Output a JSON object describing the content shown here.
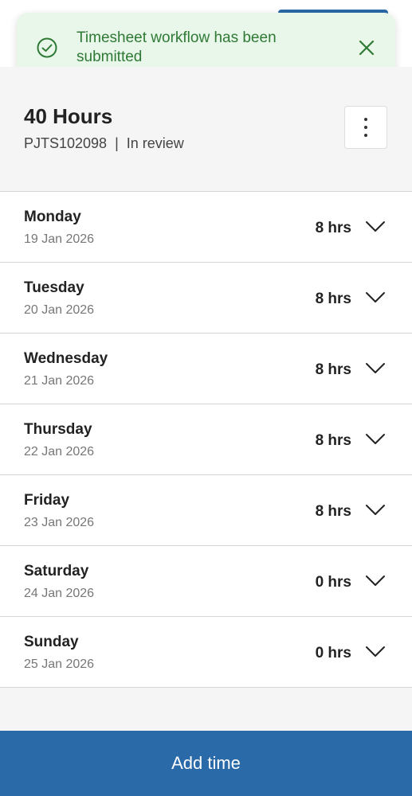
{
  "toast": {
    "message_line1": "Timesheet workflow has been",
    "message_line2": "submitted",
    "status_icon": "check-circle-icon",
    "close_icon": "close-icon",
    "color": "#2e7a35",
    "background": "#e9f6ea"
  },
  "summary": {
    "title": "40 Hours",
    "meta": "PJTS102098  |  In review",
    "more_icon": "more-vertical-icon"
  },
  "days": [
    {
      "name": "Monday",
      "date": "19 Jan 2026",
      "hours": "8 hrs"
    },
    {
      "name": "Tuesday",
      "date": "20 Jan 2026",
      "hours": "8 hrs"
    },
    {
      "name": "Wednesday",
      "date": "21 Jan 2026",
      "hours": "8 hrs"
    },
    {
      "name": "Thursday",
      "date": "22 Jan 2026",
      "hours": "8 hrs"
    },
    {
      "name": "Friday",
      "date": "23 Jan 2026",
      "hours": "8 hrs"
    },
    {
      "name": "Saturday",
      "date": "24 Jan 2026",
      "hours": "0 hrs"
    },
    {
      "name": "Sunday",
      "date": "25 Jan 2026",
      "hours": "0 hrs"
    }
  ],
  "footer": {
    "add_time_label": "Add time"
  },
  "colors": {
    "primary": "#2a6aa8",
    "background": "#f5f5f5",
    "row_border": "#d4d4d4"
  }
}
